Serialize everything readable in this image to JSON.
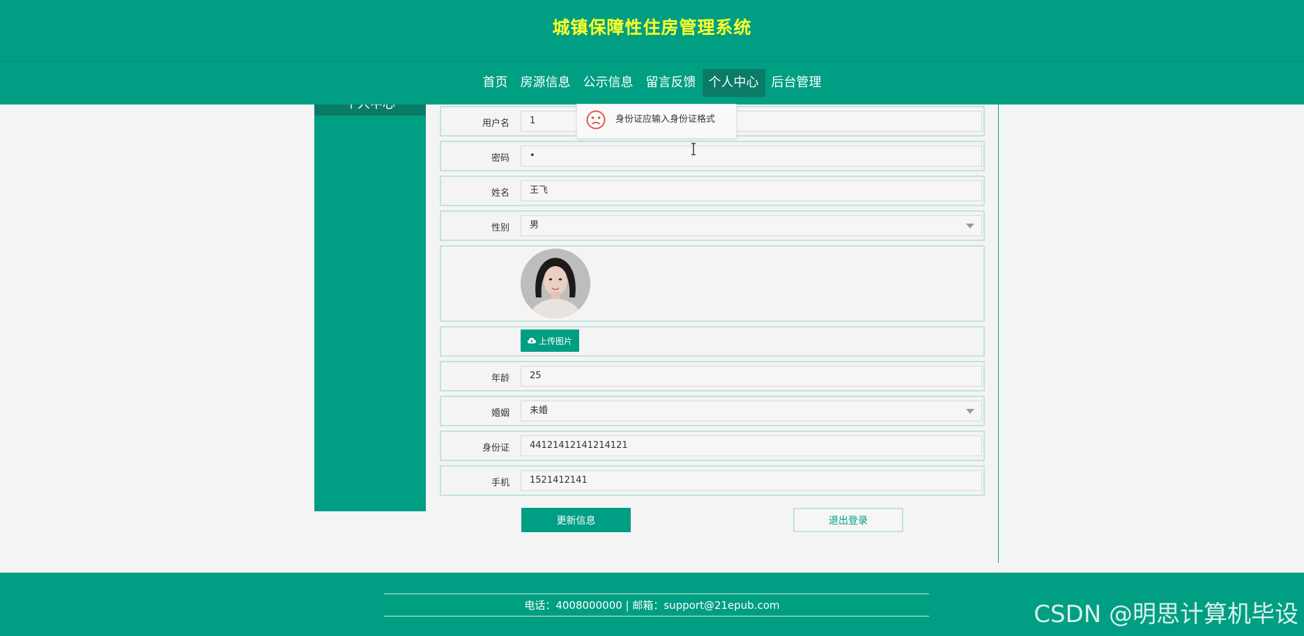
{
  "header": {
    "title": "城镇保障性住房管理系统",
    "nav": [
      {
        "label": "首页"
      },
      {
        "label": "房源信息"
      },
      {
        "label": "公示信息"
      },
      {
        "label": "留言反馈"
      },
      {
        "label": "个人中心",
        "active": true
      },
      {
        "label": "后台管理"
      }
    ]
  },
  "sidebar": {
    "title": "个人中心"
  },
  "tooltip": {
    "message": "身份证应输入身份证格式",
    "icon": "sad-face-icon"
  },
  "form": {
    "username": {
      "label": "用户名",
      "value": "1"
    },
    "password": {
      "label": "密码",
      "value": "•"
    },
    "name": {
      "label": "姓名",
      "value": "王飞"
    },
    "gender": {
      "label": "性别",
      "value": "男"
    },
    "upload_label": "上传图片",
    "age": {
      "label": "年龄",
      "value": "25"
    },
    "marriage": {
      "label": "婚姻",
      "value": "未婚"
    },
    "idcard": {
      "label": "身份证",
      "value": "44121412141214121"
    },
    "phone": {
      "label": "手机",
      "value": "1521412141"
    }
  },
  "buttons": {
    "update": "更新信息",
    "logout": "退出登录"
  },
  "footer": {
    "contact": "电话：4008000000 | 邮箱：support@21epub.com"
  },
  "watermark": "CSDN @明思计算机毕设",
  "colors": {
    "primary": "#009e83",
    "primary_dark": "#0a7b67",
    "title": "#ffff2b",
    "border": "#bfe4dc"
  }
}
